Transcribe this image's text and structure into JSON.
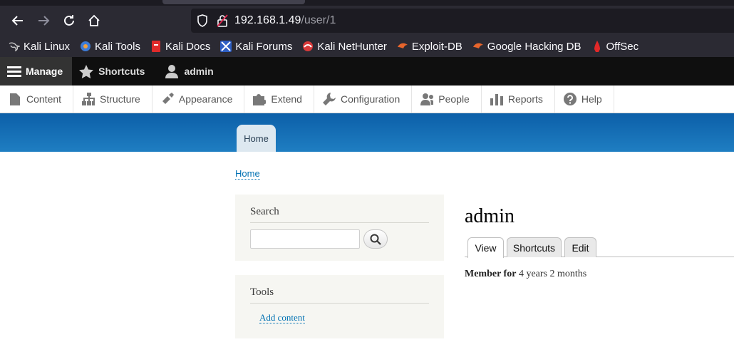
{
  "browser": {
    "url_host": "192.168.1.49",
    "url_path": "/user/1",
    "nav_icons": [
      "back-arrow-icon",
      "forward-arrow-icon",
      "reload-icon",
      "home-icon"
    ]
  },
  "bookmarks": [
    {
      "label": "Kali Linux",
      "icon": "kali-dragon-icon"
    },
    {
      "label": "Kali Tools",
      "icon": "kali-tools-icon"
    },
    {
      "label": "Kali Docs",
      "icon": "kali-docs-icon"
    },
    {
      "label": "Kali Forums",
      "icon": "kali-forums-icon"
    },
    {
      "label": "Kali NetHunter",
      "icon": "nethunter-icon"
    },
    {
      "label": "Exploit-DB",
      "icon": "exploit-db-icon"
    },
    {
      "label": "Google Hacking DB",
      "icon": "ghdb-icon"
    },
    {
      "label": "OffSec",
      "icon": "offsec-icon"
    }
  ],
  "toolbar": {
    "manage": "Manage",
    "shortcuts": "Shortcuts",
    "user": "admin"
  },
  "tray": [
    {
      "label": "Content",
      "icon": "document-icon"
    },
    {
      "label": "Structure",
      "icon": "sitemap-icon"
    },
    {
      "label": "Appearance",
      "icon": "paintbrush-icon"
    },
    {
      "label": "Extend",
      "icon": "puzzle-icon"
    },
    {
      "label": "Configuration",
      "icon": "wrench-icon"
    },
    {
      "label": "People",
      "icon": "people-icon"
    },
    {
      "label": "Reports",
      "icon": "bar-chart-icon"
    },
    {
      "label": "Help",
      "icon": "question-icon"
    }
  ],
  "header": {
    "home_tab": "Home"
  },
  "breadcrumb": "Home",
  "sidebar": {
    "search_title": "Search",
    "search_value": "",
    "tools_title": "Tools",
    "add_content": "Add content"
  },
  "main": {
    "title": "admin",
    "tabs": [
      "View",
      "Shortcuts",
      "Edit"
    ],
    "member_label": "Member for",
    "member_value": "4 years 2 months"
  },
  "colors": {
    "header_blue": "#1f7ec2",
    "link": "#0071b3",
    "toolbar": "#0f0f0f"
  }
}
